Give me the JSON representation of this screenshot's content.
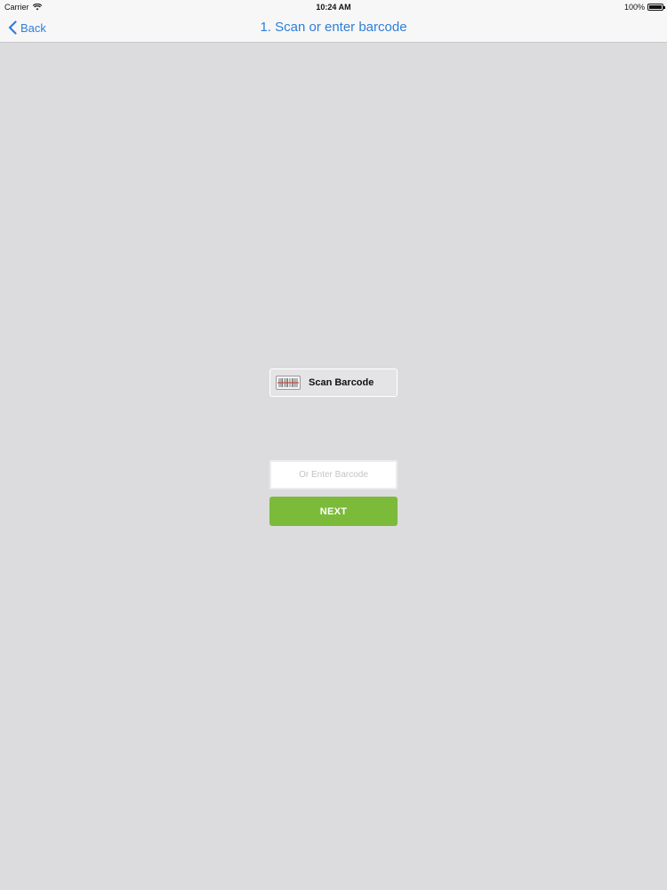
{
  "status_bar": {
    "carrier": "Carrier",
    "time": "10:24 AM",
    "battery": "100%"
  },
  "nav": {
    "back_label": "Back",
    "title": "1. Scan or enter barcode"
  },
  "scan": {
    "label": "Scan Barcode"
  },
  "barcode_input": {
    "value": "",
    "placeholder": "Or Enter Barcode"
  },
  "next": {
    "label": "NEXT"
  },
  "colors": {
    "accent": "#2f7ed8",
    "next_button": "#7cbb3a",
    "background": "#dcdcde",
    "scan_line": "#c0392b"
  },
  "icons": {
    "wifi": "wifi-icon",
    "battery": "battery-icon",
    "back": "chevron-left-icon",
    "scan": "barcode-icon"
  }
}
